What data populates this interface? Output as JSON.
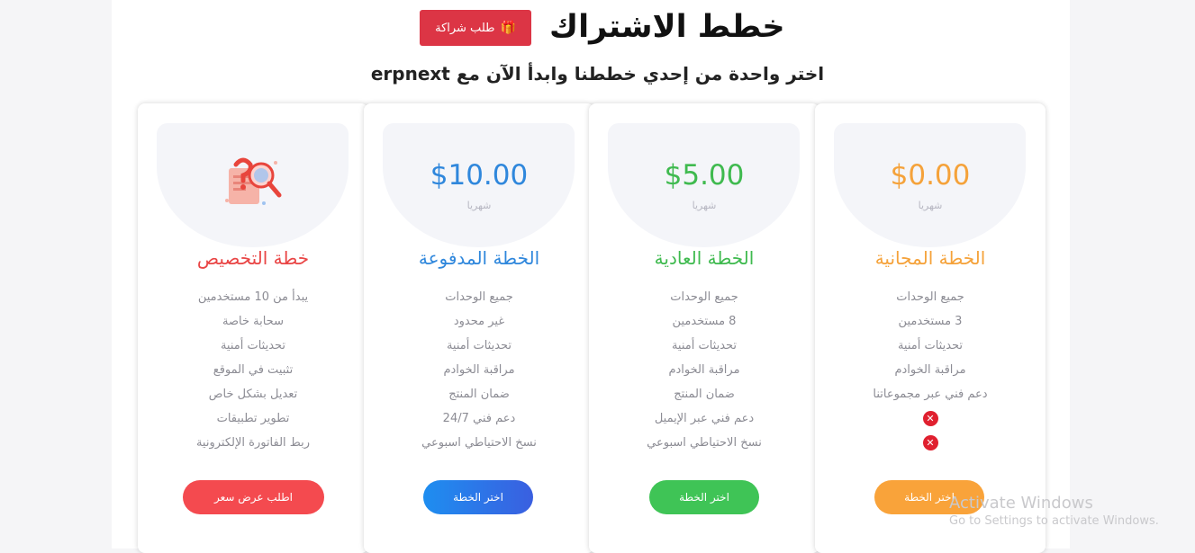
{
  "header": {
    "title": "خطط الاشتراك",
    "partner_button": "طلب شراكة",
    "subtitle": "اختر واحدة من إحدي خططنا وابدأ الآن مع erpnext"
  },
  "plans": [
    {
      "name": "الخطة المجانية",
      "price": "$0.00",
      "period": "شهريا",
      "color": "#f5a23a",
      "features": [
        "جميع الوحدات",
        "3 مستخدمين",
        "تحديثات أمنية",
        "مراقبة الخوادم",
        "دعم فني عبر مجموعاتنا"
      ],
      "unavailable_icons": [
        "x-circle-icon",
        "x-circle-icon"
      ],
      "button": "اختر الخطة"
    },
    {
      "name": "الخطة العادية",
      "price": "$5.00",
      "period": "شهريا",
      "color": "#3fba4f",
      "features": [
        "جميع الوحدات",
        "8 مستخدمين",
        "تحديثات أمنية",
        "مراقبة الخوادم",
        "ضمان المنتج",
        "دعم فني عبر الإيميل",
        "نسخ الاحتياطي اسبوعي"
      ],
      "button": "اختر الخطة"
    },
    {
      "name": "الخطة المدفوعة",
      "price": "$10.00",
      "period": "شهريا",
      "color": "#2f87dc",
      "features": [
        "جميع الوحدات",
        "غير محدود",
        "تحديثات أمنية",
        "مراقبة الخوادم",
        "ضمان المنتج",
        "دعم فني 24/7",
        "نسخ الاحتياطي اسبوعي"
      ],
      "button": "اختر الخطة"
    },
    {
      "name": "خطة التخصيص",
      "color": "#e94545",
      "illustration": "question-magnifier-icon",
      "features": [
        "يبدأ من 10 مستخدمين",
        "سحابة خاصة",
        "تحديثات أمنية",
        "تثبيت في الموقع",
        "تعديل بشكل خاص",
        "تطوير تطبيقات",
        "ربط الفاتورة الإلكترونية"
      ],
      "button": "اطلب عرض سعر"
    }
  ],
  "watermark": {
    "line1": "Activate Windows",
    "line2": "Go to Settings to activate Windows."
  }
}
